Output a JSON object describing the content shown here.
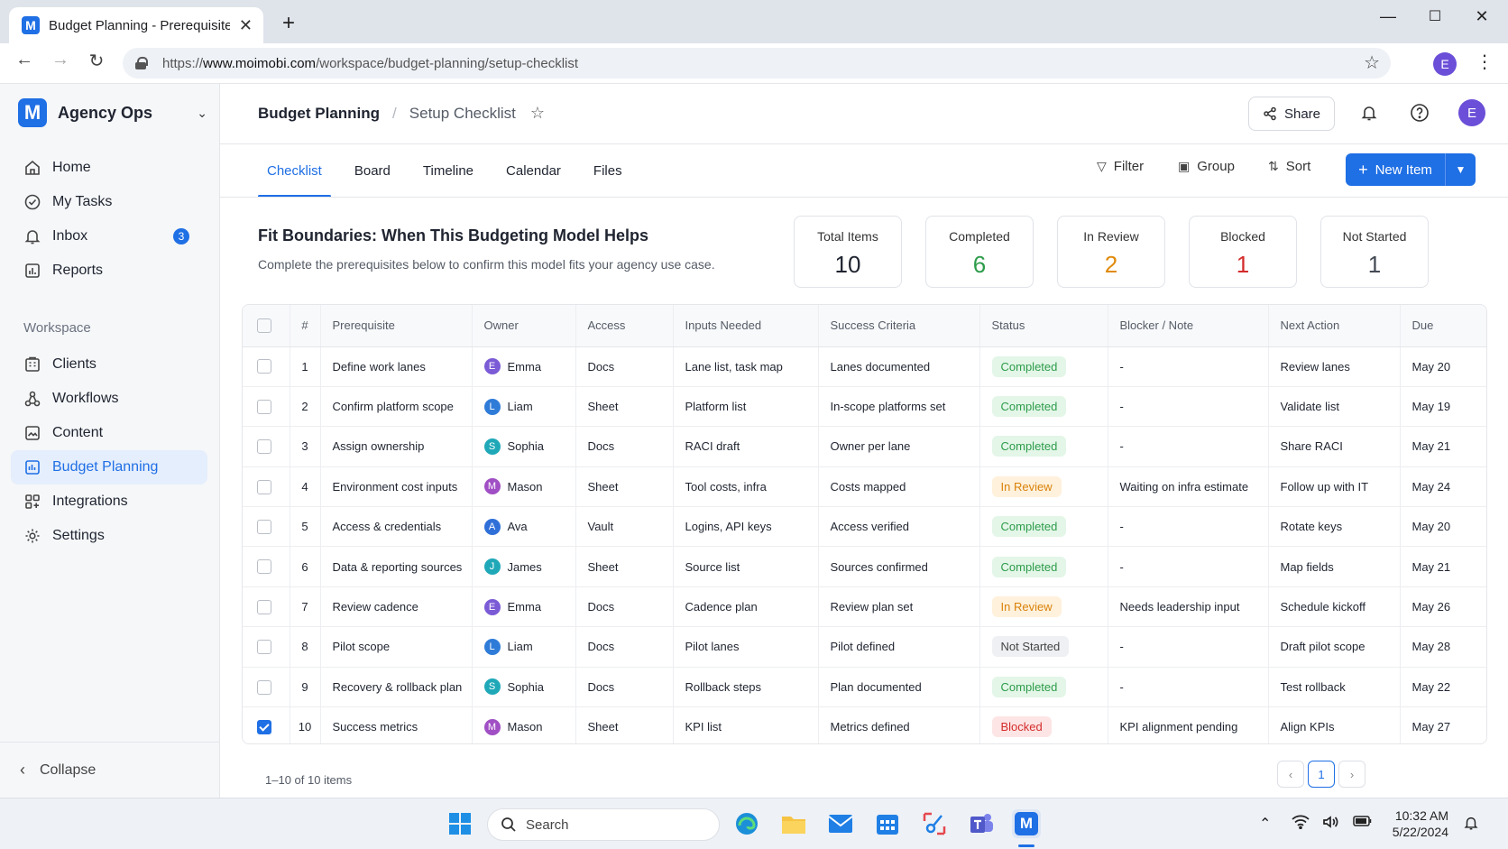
{
  "browser": {
    "tab_title": "Budget Planning - Prerequisite C",
    "favicon_letter": "M",
    "url_prefix": "https://",
    "url_domain": "www.moimobi.com",
    "url_path": "/workspace/budget-planning/setup-checklist",
    "profile_letter": "E"
  },
  "sidebar": {
    "workspace_logo": "M",
    "workspace_name": "Agency Ops",
    "items": [
      {
        "label": "Home",
        "icon": "home-icon"
      },
      {
        "label": "My Tasks",
        "icon": "check-circle-icon"
      },
      {
        "label": "Inbox",
        "icon": "bell-icon",
        "badge": "3"
      },
      {
        "label": "Reports",
        "icon": "bar-chart-icon"
      }
    ],
    "section_label": "Workspace",
    "workspace_items": [
      {
        "label": "Clients",
        "icon": "building-icon"
      },
      {
        "label": "Workflows",
        "icon": "workflow-icon"
      },
      {
        "label": "Content",
        "icon": "image-icon"
      },
      {
        "label": "Budget Planning",
        "icon": "budget-icon",
        "active": true
      },
      {
        "label": "Integrations",
        "icon": "integrations-icon"
      },
      {
        "label": "Settings",
        "icon": "gear-icon"
      }
    ],
    "collapse_label": "Collapse"
  },
  "header": {
    "breadcrumb_root": "Budget Planning",
    "breadcrumb_page": "Setup Checklist",
    "share_label": "Share",
    "avatar_letter": "E"
  },
  "tabs": [
    "Checklist",
    "Board",
    "Timeline",
    "Calendar",
    "Files"
  ],
  "toolbar": {
    "filter_label": "Filter",
    "group_label": "Group",
    "sort_label": "Sort",
    "new_item_label": "New Item"
  },
  "intro": {
    "title": "Fit Boundaries: When This Budgeting Model Helps",
    "subtitle": "Complete the prerequisites below to confirm this model fits your agency use case."
  },
  "stats": [
    {
      "label": "Total Items",
      "value": "10",
      "color": "#1f2430"
    },
    {
      "label": "Completed",
      "value": "6",
      "color": "#2e9c4b"
    },
    {
      "label": "In Review",
      "value": "2",
      "color": "#e08a0b"
    },
    {
      "label": "Blocked",
      "value": "1",
      "color": "#d42b2b"
    },
    {
      "label": "Not Started",
      "value": "1",
      "color": "#444a55"
    }
  ],
  "table": {
    "columns": [
      "#",
      "Prerequisite",
      "Owner",
      "Access",
      "Inputs Needed",
      "Success Criteria",
      "Status",
      "Blocker / Note",
      "Next Action",
      "Due"
    ],
    "rows": [
      {
        "checked": false,
        "num": "1",
        "prereq": "Define work lanes",
        "owner": "Emma",
        "owner_color": "#7b5bd6",
        "access": "Docs",
        "inputs": "Lane list, task map",
        "criteria": "Lanes documented",
        "status": "Completed",
        "status_class": "completed",
        "note": "-",
        "next": "Review lanes",
        "due": "May 20"
      },
      {
        "checked": false,
        "num": "2",
        "prereq": "Confirm platform scope",
        "owner": "Liam",
        "owner_color": "#2f7bd8",
        "access": "Sheet",
        "inputs": "Platform list",
        "criteria": "In-scope platforms set",
        "status": "Completed",
        "status_class": "completed",
        "note": "-",
        "next": "Validate list",
        "due": "May 19"
      },
      {
        "checked": false,
        "num": "3",
        "prereq": "Assign ownership",
        "owner": "Sophia",
        "owner_color": "#1fa8b8",
        "access": "Docs",
        "inputs": "RACI draft",
        "criteria": "Owner per lane",
        "status": "Completed",
        "status_class": "completed",
        "note": "-",
        "next": "Share RACI",
        "due": "May 21"
      },
      {
        "checked": false,
        "num": "4",
        "prereq": "Environment cost inputs",
        "owner": "Mason",
        "owner_color": "#a04fc4",
        "access": "Sheet",
        "inputs": "Tool costs, infra",
        "criteria": "Costs mapped",
        "status": "In Review",
        "status_class": "review",
        "note": "Waiting on infra estimate",
        "next": "Follow up with IT",
        "due": "May 24"
      },
      {
        "checked": false,
        "num": "5",
        "prereq": "Access & credentials",
        "owner": "Ava",
        "owner_color": "#2f6fd8",
        "access": "Vault",
        "inputs": "Logins, API keys",
        "criteria": "Access verified",
        "status": "Completed",
        "status_class": "completed",
        "note": "-",
        "next": "Rotate keys",
        "due": "May 20"
      },
      {
        "checked": false,
        "num": "6",
        "prereq": "Data & reporting sources",
        "owner": "James",
        "owner_color": "#1fa8b8",
        "access": "Sheet",
        "inputs": "Source list",
        "criteria": "Sources confirmed",
        "status": "Completed",
        "status_class": "completed",
        "note": "-",
        "next": "Map fields",
        "due": "May 21"
      },
      {
        "checked": false,
        "num": "7",
        "prereq": "Review cadence",
        "owner": "Emma",
        "owner_color": "#7b5bd6",
        "access": "Docs",
        "inputs": "Cadence plan",
        "criteria": "Review plan set",
        "status": "In Review",
        "status_class": "review",
        "note": "Needs leadership input",
        "next": "Schedule kickoff",
        "due": "May 26"
      },
      {
        "checked": false,
        "num": "8",
        "prereq": "Pilot scope",
        "owner": "Liam",
        "owner_color": "#2f7bd8",
        "access": "Docs",
        "inputs": "Pilot lanes",
        "criteria": "Pilot defined",
        "status": "Not Started",
        "status_class": "notstarted",
        "note": "-",
        "next": "Draft pilot scope",
        "due": "May 28"
      },
      {
        "checked": false,
        "num": "9",
        "prereq": "Recovery & rollback plan",
        "owner": "Sophia",
        "owner_color": "#1fa8b8",
        "access": "Docs",
        "inputs": "Rollback steps",
        "criteria": "Plan documented",
        "status": "Completed",
        "status_class": "completed",
        "note": "-",
        "next": "Test rollback",
        "due": "May 22"
      },
      {
        "checked": true,
        "num": "10",
        "prereq": "Success metrics",
        "owner": "Mason",
        "owner_color": "#a04fc4",
        "access": "Sheet",
        "inputs": "KPI list",
        "criteria": "Metrics defined",
        "status": "Blocked",
        "status_class": "blocked",
        "note": "KPI alignment pending",
        "next": "Align KPIs",
        "due": "May 27"
      }
    ],
    "footer_text": "1–10 of 10 items",
    "current_page": "1"
  },
  "taskbar": {
    "search_label": "Search",
    "time": "10:32 AM",
    "date": "5/22/2024"
  }
}
